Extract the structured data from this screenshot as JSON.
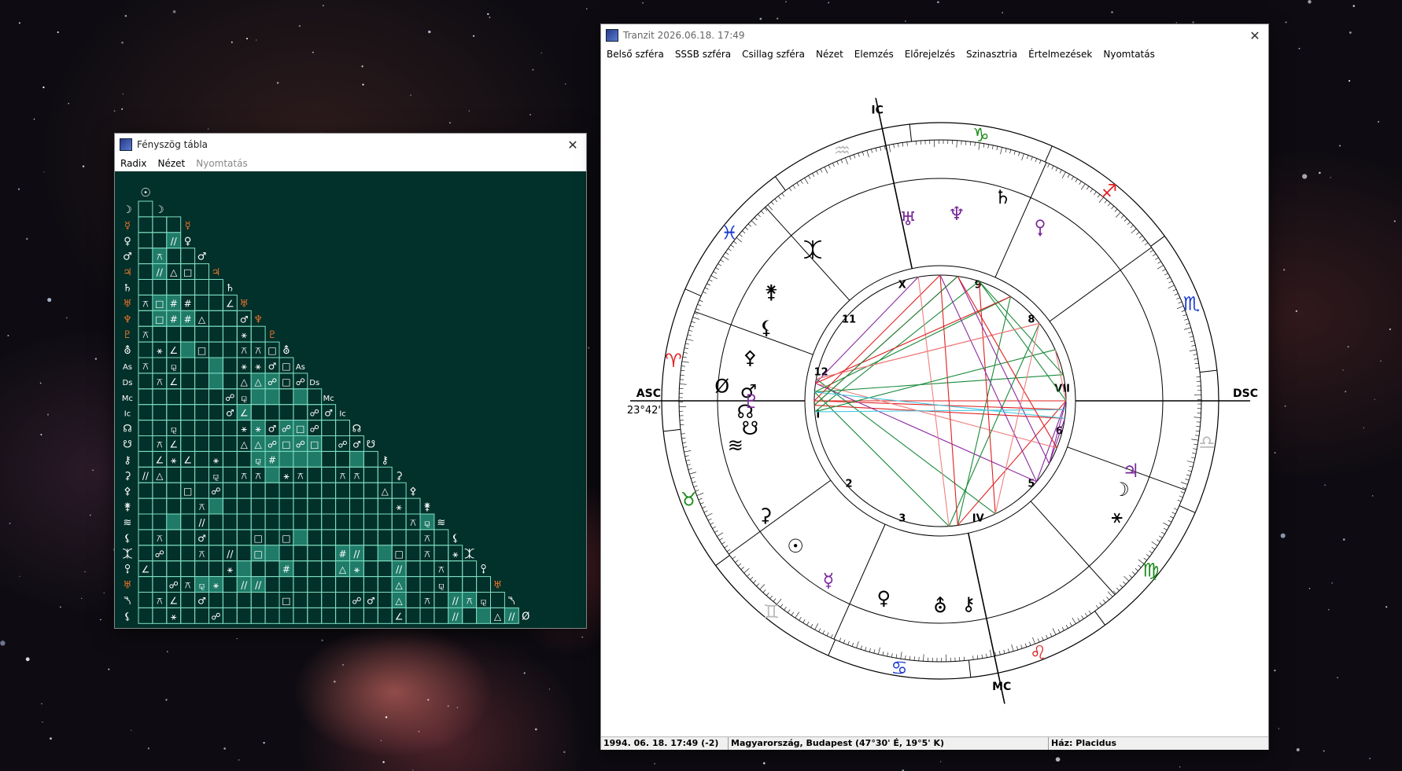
{
  "desktop": {
    "background": "starfield-nebula"
  },
  "aspect_window": {
    "title": "Fényszög tábla",
    "close": "✕",
    "menu": [
      {
        "label": "Radix",
        "enabled": true
      },
      {
        "label": "Nézet",
        "enabled": true
      },
      {
        "label": "Nyomtatás",
        "enabled": false
      }
    ],
    "grid_color": "#7fe0c4",
    "highlight_color": "#1f7a68",
    "bg_color": "#02302a",
    "rows": [
      {
        "sym": "☽",
        "color": "#ffffff",
        "cells": [
          ""
        ]
      },
      {
        "sym": "☿",
        "color": "#e8732a",
        "cells": [
          "",
          "",
          ""
        ]
      },
      {
        "sym": "♀",
        "color": "#ffffff",
        "cells": [
          "",
          "",
          "//"
        ]
      },
      {
        "sym": "♂",
        "color": "#ffffff",
        "cells": [
          "",
          "⚻",
          "",
          ""
        ]
      },
      {
        "sym": "♃",
        "color": "#e8732a",
        "cells": [
          "",
          "//",
          "△",
          "□",
          ""
        ]
      },
      {
        "sym": "♄",
        "color": "#ffffff",
        "cells": [
          "",
          "",
          "",
          "",
          "",
          ""
        ]
      },
      {
        "sym": "♅",
        "color": "#e8732a",
        "cells": [
          "⚻",
          "□",
          "#",
          "#",
          "",
          "",
          "∠"
        ]
      },
      {
        "sym": "♆",
        "color": "#e8732a",
        "cells": [
          "",
          "□",
          "#",
          "#",
          "△",
          "",
          "",
          "♂"
        ]
      },
      {
        "sym": "♇",
        "color": "#e8732a",
        "cells": [
          "⚻",
          "",
          "",
          "",
          "",
          "",
          "",
          "⚹",
          ""
        ]
      },
      {
        "sym": "⛢",
        "color": "#ffffff",
        "cells": [
          "",
          "⚹",
          "∠",
          "",
          "□",
          "",
          "",
          "⚻",
          "⚻",
          "□"
        ]
      },
      {
        "sym": "As",
        "color": "#ffffff",
        "cells": [
          "⚻",
          "",
          "⚼",
          "",
          "",
          "",
          "",
          "⚹",
          "⚹",
          "♂",
          "□"
        ]
      },
      {
        "sym": "Ds",
        "color": "#ffffff",
        "cells": [
          "",
          "⚻",
          "∠",
          "",
          "",
          "",
          "",
          "△",
          "△",
          "☍",
          "□",
          "☍"
        ]
      },
      {
        "sym": "Mc",
        "color": "#ffffff",
        "cells": [
          "",
          "",
          "",
          "",
          "",
          "",
          "☍",
          "⚼",
          "",
          "",
          "",
          "",
          ""
        ]
      },
      {
        "sym": "Ic",
        "color": "#ffffff",
        "cells": [
          "",
          "",
          "",
          "",
          "",
          "",
          "♂",
          "∠",
          "",
          "",
          "",
          "",
          "☍",
          "♂"
        ]
      },
      {
        "sym": "☊",
        "color": "#ffffff",
        "cells": [
          "",
          "",
          "⚼",
          "",
          "",
          "",
          "",
          "⚹",
          "⚹",
          "♂",
          "☍",
          "□",
          "☍",
          "",
          ""
        ]
      },
      {
        "sym": "☋",
        "color": "#ffffff",
        "cells": [
          "",
          "⚻",
          "∠",
          "",
          "",
          "",
          "",
          "△",
          "△",
          "☍",
          "□",
          "☍",
          "□",
          "",
          "☍",
          "♂"
        ]
      },
      {
        "sym": "⚷",
        "color": "#ffffff",
        "cells": [
          "",
          "∠",
          "⚹",
          "∠",
          "",
          "⚹",
          "",
          "",
          "⚼",
          "#",
          "",
          "",
          "",
          "",
          "",
          "",
          ""
        ]
      },
      {
        "sym": "⚳",
        "color": "#ffffff",
        "cells": [
          "//",
          "△",
          "",
          "",
          "",
          "⚼",
          "",
          "⚻",
          "⚻",
          "",
          "⚹",
          "⚻",
          "",
          "",
          "⚻",
          "⚻",
          "",
          ""
        ]
      },
      {
        "sym": "⚴",
        "color": "#ffffff",
        "cells": [
          "",
          "",
          "",
          "□",
          "",
          "☍",
          "",
          "",
          "",
          "",
          "",
          "",
          "",
          "",
          "",
          "",
          "",
          "△",
          ""
        ]
      },
      {
        "sym": "⚵",
        "color": "#ffffff",
        "cells": [
          "",
          "",
          "",
          "",
          "⚻",
          "",
          "",
          "",
          "",
          "",
          "",
          "",
          "",
          "",
          "",
          "",
          "",
          "",
          "⚹",
          ""
        ]
      },
      {
        "sym": "≋",
        "color": "#ffffff",
        "cells": [
          "",
          "",
          "",
          "",
          "//",
          "",
          "",
          "",
          "",
          "",
          "",
          "",
          "",
          "",
          "",
          "",
          "",
          "",
          "",
          "⚻",
          "⚼"
        ]
      },
      {
        "sym": "⚸",
        "color": "#ffffff",
        "cells": [
          "",
          "⚻",
          "",
          "",
          "♂",
          "",
          "",
          "",
          "□",
          "",
          "□",
          "",
          "",
          "",
          "",
          "",
          "",
          "",
          "",
          "",
          "⚻",
          ""
        ]
      },
      {
        "sym": "⯰",
        "color": "#ffffff",
        "cells": [
          "",
          "☍",
          "",
          "",
          "⚻",
          "",
          "//",
          "",
          "□",
          "",
          "",
          "",
          "",
          "",
          "#",
          "//",
          "",
          "",
          "□",
          "",
          "⚻",
          "",
          "⚹"
        ]
      },
      {
        "sym": "⯱",
        "color": "#ffffff",
        "cells": [
          "∠",
          "",
          "",
          "",
          "",
          "",
          "⚹",
          "",
          "",
          "",
          "#",
          "",
          "",
          "",
          "△",
          "⚹",
          "",
          "",
          "//",
          "",
          "",
          "⚻",
          "",
          ""
        ]
      },
      {
        "sym": "♅",
        "color": "#e8732a",
        "cells": [
          "",
          "",
          "☍",
          "⚻",
          "⚼",
          "⚹",
          "",
          "//",
          "//",
          "",
          "",
          "",
          "",
          "",
          "",
          "",
          "",
          "",
          "△",
          "",
          "",
          "⚼",
          "",
          "",
          ""
        ]
      },
      {
        "sym": "⯲",
        "color": "#ffffff",
        "cells": [
          "",
          "⚻",
          "∠",
          "",
          "♂",
          "",
          "",
          "",
          "",
          "",
          "□",
          "",
          "",
          "",
          "",
          "☍",
          "♂",
          "",
          "△",
          "",
          "⚻",
          "",
          "//",
          "⚻",
          "⚼",
          ""
        ]
      },
      {
        "sym": "⚸",
        "color": "#ffffff",
        "cells": [
          "",
          "",
          "⚹",
          "",
          "",
          "☍",
          "",
          "",
          "",
          "",
          "",
          "",
          "",
          "",
          "",
          "",
          "",
          "",
          "∠",
          "",
          "",
          "",
          "//",
          "",
          "",
          "△",
          "//"
        ]
      }
    ],
    "bottom_labels": [
      "☉",
      "☽",
      "☿",
      "♀",
      "♂",
      "♃",
      "♄",
      "♅",
      "♆",
      "♇",
      "⛢",
      "As",
      "Ds",
      "Mc",
      "Ic",
      "☊",
      "☋",
      "⚷",
      "⚳",
      "⚴",
      "⚵",
      "≋",
      "⚸",
      "⯰",
      "⯱",
      "♅",
      "⯲",
      "Ø"
    ],
    "top_label": "☉",
    "highlight_cells": [
      [
        2,
        2
      ],
      [
        3,
        1
      ],
      [
        4,
        1
      ],
      [
        6,
        1
      ],
      [
        6,
        2
      ],
      [
        7,
        1
      ],
      [
        7,
        2
      ],
      [
        7,
        3
      ],
      [
        9,
        3
      ],
      [
        10,
        5
      ],
      [
        11,
        5
      ],
      [
        11,
        8
      ],
      [
        11,
        9
      ],
      [
        12,
        8
      ],
      [
        12,
        9
      ],
      [
        12,
        11
      ],
      [
        13,
        7
      ],
      [
        14,
        8
      ],
      [
        14,
        10
      ],
      [
        14,
        11
      ],
      [
        15,
        8
      ],
      [
        15,
        9
      ],
      [
        15,
        10
      ],
      [
        15,
        11
      ],
      [
        15,
        12
      ],
      [
        16,
        8
      ],
      [
        16,
        9
      ],
      [
        16,
        10
      ],
      [
        16,
        11
      ],
      [
        16,
        12
      ],
      [
        16,
        15
      ],
      [
        17,
        9
      ],
      [
        19,
        5
      ],
      [
        20,
        2
      ],
      [
        20,
        20
      ],
      [
        21,
        11
      ],
      [
        22,
        8
      ],
      [
        22,
        9
      ],
      [
        22,
        14
      ],
      [
        22,
        15
      ],
      [
        22,
        17
      ],
      [
        23,
        7
      ],
      [
        23,
        10
      ],
      [
        23,
        14
      ],
      [
        23,
        15
      ],
      [
        23,
        18
      ],
      [
        24,
        4
      ],
      [
        24,
        5
      ],
      [
        24,
        7
      ],
      [
        24,
        8
      ],
      [
        24,
        18
      ],
      [
        25,
        18
      ],
      [
        25,
        22
      ],
      [
        25,
        23
      ],
      [
        26,
        22
      ],
      [
        26,
        24
      ],
      [
        26,
        26
      ]
    ]
  },
  "chart_window": {
    "title": "Tranzit 2026.06.18. 17:49",
    "close": "✕",
    "menu": [
      {
        "label": "Belső szféra"
      },
      {
        "label": "SSSB szféra"
      },
      {
        "label": "Csillag szféra"
      },
      {
        "label": "Nézet"
      },
      {
        "label": "Elemzés"
      },
      {
        "label": "Előrejelzés"
      },
      {
        "label": "Szinasztria"
      },
      {
        "label": "Értelmezések"
      },
      {
        "label": "Nyomtatás"
      }
    ],
    "angles": {
      "asc": "ASC",
      "asc_degree": "23°42'",
      "dsc": "DSC",
      "mc": "MC",
      "ic": "IC"
    },
    "house_labels": [
      "I",
      "2",
      "3",
      "IV",
      "5",
      "6",
      "VII",
      "8",
      "9",
      "X",
      "11",
      "12"
    ],
    "signs": [
      {
        "glyph": "♈",
        "color": "#e02020"
      },
      {
        "glyph": "♉",
        "color": "#1a8a1a"
      },
      {
        "glyph": "♊",
        "color": "#bbbbbb"
      },
      {
        "glyph": "♋",
        "color": "#1a3ad0"
      },
      {
        "glyph": "♌",
        "color": "#e02020"
      },
      {
        "glyph": "♍",
        "color": "#1a8a1a"
      },
      {
        "glyph": "♎",
        "color": "#bbbbbb"
      },
      {
        "glyph": "♏",
        "color": "#1a3ad0"
      },
      {
        "glyph": "♐",
        "color": "#e02020"
      },
      {
        "glyph": "♑",
        "color": "#1a8a1a"
      },
      {
        "glyph": "♒",
        "color": "#bbbbbb"
      },
      {
        "glyph": "♓",
        "color": "#1a3ad0"
      }
    ],
    "transit_planets": [
      {
        "glyph": "⚷",
        "color": "#000000"
      },
      {
        "glyph": "⛢",
        "color": "#000000"
      },
      {
        "glyph": "♀",
        "color": "#000000"
      },
      {
        "glyph": "☿",
        "color": "#7a2a9a"
      },
      {
        "glyph": "☉",
        "color": "#000000"
      },
      {
        "glyph": "⚳",
        "color": "#000000"
      },
      {
        "glyph": "≋",
        "color": "#000000"
      },
      {
        "glyph": "☋",
        "color": "#000000"
      },
      {
        "glyph": "♂",
        "color": "#000000"
      },
      {
        "glyph": "Ø",
        "color": "#000000"
      },
      {
        "glyph": "⚴",
        "color": "#000000"
      },
      {
        "glyph": "⚸",
        "color": "#000000"
      },
      {
        "glyph": "⚵",
        "color": "#000000"
      },
      {
        "glyph": "⯰",
        "color": "#000000"
      },
      {
        "glyph": "♅",
        "color": "#7a2a9a"
      },
      {
        "glyph": "♆",
        "color": "#7a2a9a"
      },
      {
        "glyph": "⯱",
        "color": "#7a2a9a"
      },
      {
        "glyph": "♄",
        "color": "#000000"
      },
      {
        "glyph": "☊",
        "color": "#000000"
      },
      {
        "glyph": "♇",
        "color": "#7a2a9a"
      },
      {
        "glyph": "♃",
        "color": "#7a2a9a"
      },
      {
        "glyph": "☽",
        "color": "#000000"
      },
      {
        "glyph": "⚹",
        "color": "#000000"
      }
    ],
    "aspect_colors": {
      "harmonic": "#1a8a3a",
      "tense": "#e02020",
      "minor": "#8a2aa0",
      "light_red": "#f08080",
      "cyan": "#40c8e0"
    }
  },
  "status": {
    "datetime": "1994. 06. 18.  17:49 (-2)",
    "location": "Magyarország, Budapest (47°30' É,  19°5' K)",
    "houses": "Ház: Placidus"
  }
}
